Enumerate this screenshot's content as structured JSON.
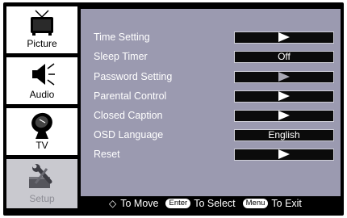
{
  "sidebar": {
    "tabs": [
      {
        "label": "Picture",
        "icon": "tv-icon"
      },
      {
        "label": "Audio",
        "icon": "speaker-icon"
      },
      {
        "label": "TV",
        "icon": "satellite-dish-icon"
      },
      {
        "label": "Setup",
        "icon": "tools-icon",
        "active": true
      }
    ]
  },
  "menu": {
    "items": [
      {
        "label": "Time Setting",
        "value": "",
        "control": "arrow"
      },
      {
        "label": "Sleep Timer",
        "value": "Off",
        "control": "text"
      },
      {
        "label": "Password Setting",
        "value": "",
        "control": "arrow-dim"
      },
      {
        "label": "Parental Control",
        "value": "",
        "control": "arrow"
      },
      {
        "label": "Closed Caption",
        "value": "",
        "control": "arrow"
      },
      {
        "label": "OSD Language",
        "value": "English",
        "control": "text"
      },
      {
        "label": "Reset",
        "value": "",
        "control": "arrow"
      }
    ]
  },
  "footer": {
    "move_symbol": "◇",
    "move_label": "To Move",
    "enter_key": "Enter",
    "select_label": "To Select",
    "menu_key": "Menu",
    "exit_label": "To Exit"
  },
  "colors": {
    "panel": "#9b9ab0",
    "setup_tab": "#c9c9cf",
    "frame": "#000000"
  }
}
